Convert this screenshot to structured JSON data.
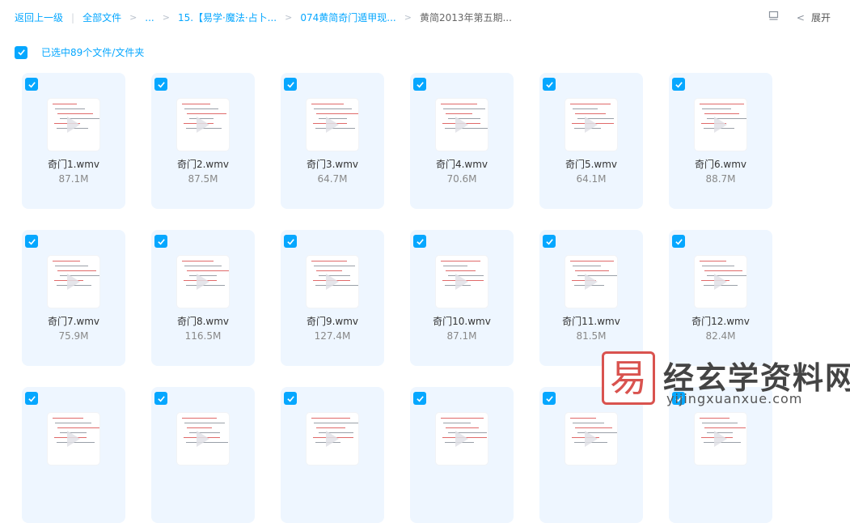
{
  "breadcrumb": {
    "back": "返回上一级",
    "all_files": "全部文件",
    "ellipsis": "...",
    "folder1": "15.【易学·魔法·占卜...",
    "folder2": "074黄简奇门遁甲现...",
    "current": "黄简2013年第五期..."
  },
  "toolbar": {
    "list_icon": "list-view-icon",
    "expand_label": "展开"
  },
  "selection": {
    "label": "已选中89个文件/文件夹"
  },
  "files": [
    {
      "name": "奇门1.wmv",
      "size": "87.1M"
    },
    {
      "name": "奇门2.wmv",
      "size": "87.5M"
    },
    {
      "name": "奇门3.wmv",
      "size": "64.7M"
    },
    {
      "name": "奇门4.wmv",
      "size": "70.6M"
    },
    {
      "name": "奇门5.wmv",
      "size": "64.1M"
    },
    {
      "name": "奇门6.wmv",
      "size": "88.7M"
    },
    {
      "name": "奇门7.wmv",
      "size": "75.9M"
    },
    {
      "name": "奇门8.wmv",
      "size": "116.5M"
    },
    {
      "name": "奇门9.wmv",
      "size": "127.4M"
    },
    {
      "name": "奇门10.wmv",
      "size": "87.1M"
    },
    {
      "name": "奇门11.wmv",
      "size": "81.5M"
    },
    {
      "name": "奇门12.wmv",
      "size": "82.4M"
    },
    {
      "name": "",
      "size": ""
    },
    {
      "name": "",
      "size": ""
    },
    {
      "name": "",
      "size": ""
    },
    {
      "name": "",
      "size": ""
    },
    {
      "name": "",
      "size": ""
    },
    {
      "name": "",
      "size": ""
    }
  ],
  "watermark": {
    "seal": "易",
    "brand": "经玄学资料网",
    "url": "yijingxuanxue.com"
  },
  "colors": {
    "accent": "#06a7ff",
    "card_bg": "#eef6ff"
  }
}
